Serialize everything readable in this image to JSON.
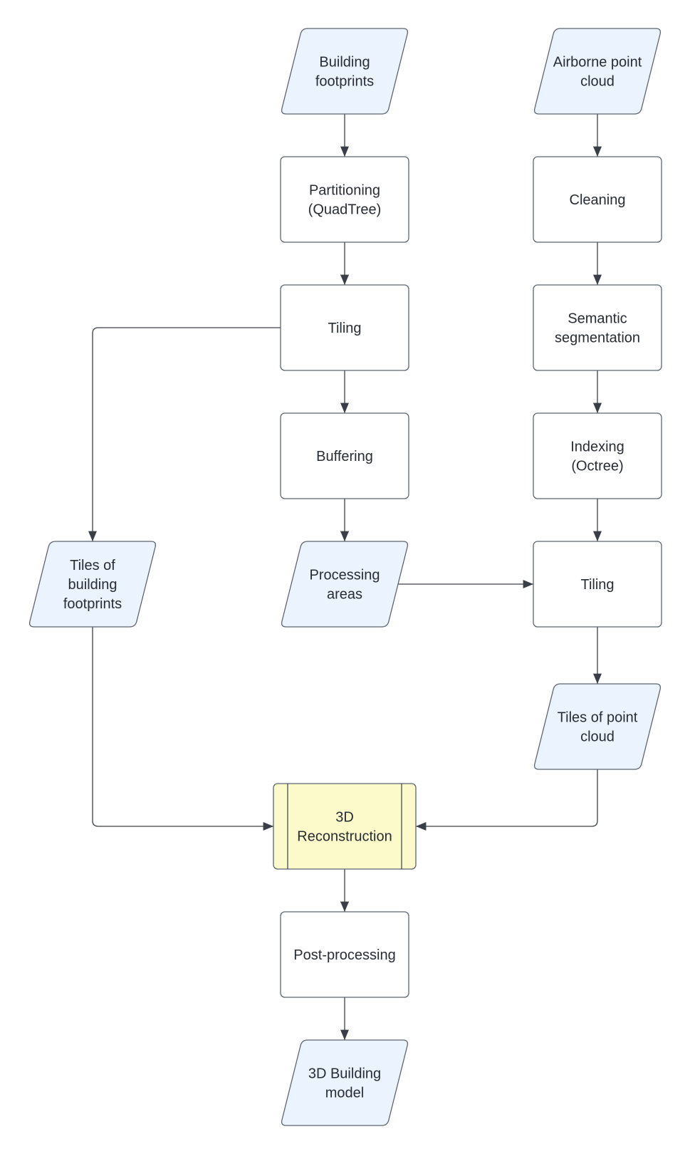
{
  "colors": {
    "data_fill": "#ebf3fe",
    "process_fill": "#ffffff",
    "subprocess_fill": "#fcf9cb",
    "stroke": "#5e6470",
    "text": "#282c33",
    "edge": "#3a3f47"
  },
  "nodes": [
    {
      "id": "building-footprints",
      "shape": "data",
      "lines": [
        "Building",
        "footprints"
      ]
    },
    {
      "id": "airborne-point-cloud",
      "shape": "data",
      "lines": [
        "Airborne point",
        "cloud"
      ]
    },
    {
      "id": "partitioning",
      "shape": "process",
      "lines": [
        "Partitioning",
        "(QuadTree)"
      ]
    },
    {
      "id": "cleaning",
      "shape": "process",
      "lines": [
        "Cleaning"
      ]
    },
    {
      "id": "tiling-footprints",
      "shape": "process",
      "lines": [
        "Tiling"
      ]
    },
    {
      "id": "semantic-segmentation",
      "shape": "process",
      "lines": [
        "Semantic",
        "segmentation"
      ]
    },
    {
      "id": "buffering",
      "shape": "process",
      "lines": [
        "Buffering"
      ]
    },
    {
      "id": "indexing",
      "shape": "process",
      "lines": [
        "Indexing",
        "(Octree)"
      ]
    },
    {
      "id": "tiles-building-footprints",
      "shape": "data",
      "lines": [
        "Tiles of",
        "building",
        "footprints"
      ]
    },
    {
      "id": "processing-areas",
      "shape": "data",
      "lines": [
        "Processing",
        "areas"
      ]
    },
    {
      "id": "tiling-pointcloud",
      "shape": "process",
      "lines": [
        "Tiling"
      ]
    },
    {
      "id": "tiles-point-cloud",
      "shape": "data",
      "lines": [
        "Tiles of point",
        "cloud"
      ]
    },
    {
      "id": "reconstruction",
      "shape": "subprocess",
      "lines": [
        "3D",
        "Reconstruction"
      ]
    },
    {
      "id": "post-processing",
      "shape": "process",
      "lines": [
        "Post-processing"
      ]
    },
    {
      "id": "building-model",
      "shape": "data",
      "lines": [
        "3D Building",
        "model"
      ]
    }
  ],
  "edges": [
    {
      "from": "building-footprints",
      "to": "partitioning"
    },
    {
      "from": "partitioning",
      "to": "tiling-footprints"
    },
    {
      "from": "tiling-footprints",
      "to": "buffering"
    },
    {
      "from": "tiling-footprints",
      "to": "tiles-building-footprints"
    },
    {
      "from": "buffering",
      "to": "processing-areas"
    },
    {
      "from": "processing-areas",
      "to": "tiling-pointcloud"
    },
    {
      "from": "airborne-point-cloud",
      "to": "cleaning"
    },
    {
      "from": "cleaning",
      "to": "semantic-segmentation"
    },
    {
      "from": "semantic-segmentation",
      "to": "indexing"
    },
    {
      "from": "indexing",
      "to": "tiling-pointcloud"
    },
    {
      "from": "tiling-pointcloud",
      "to": "tiles-point-cloud"
    },
    {
      "from": "tiles-building-footprints",
      "to": "reconstruction"
    },
    {
      "from": "tiles-point-cloud",
      "to": "reconstruction"
    },
    {
      "from": "reconstruction",
      "to": "post-processing"
    },
    {
      "from": "post-processing",
      "to": "building-model"
    }
  ]
}
